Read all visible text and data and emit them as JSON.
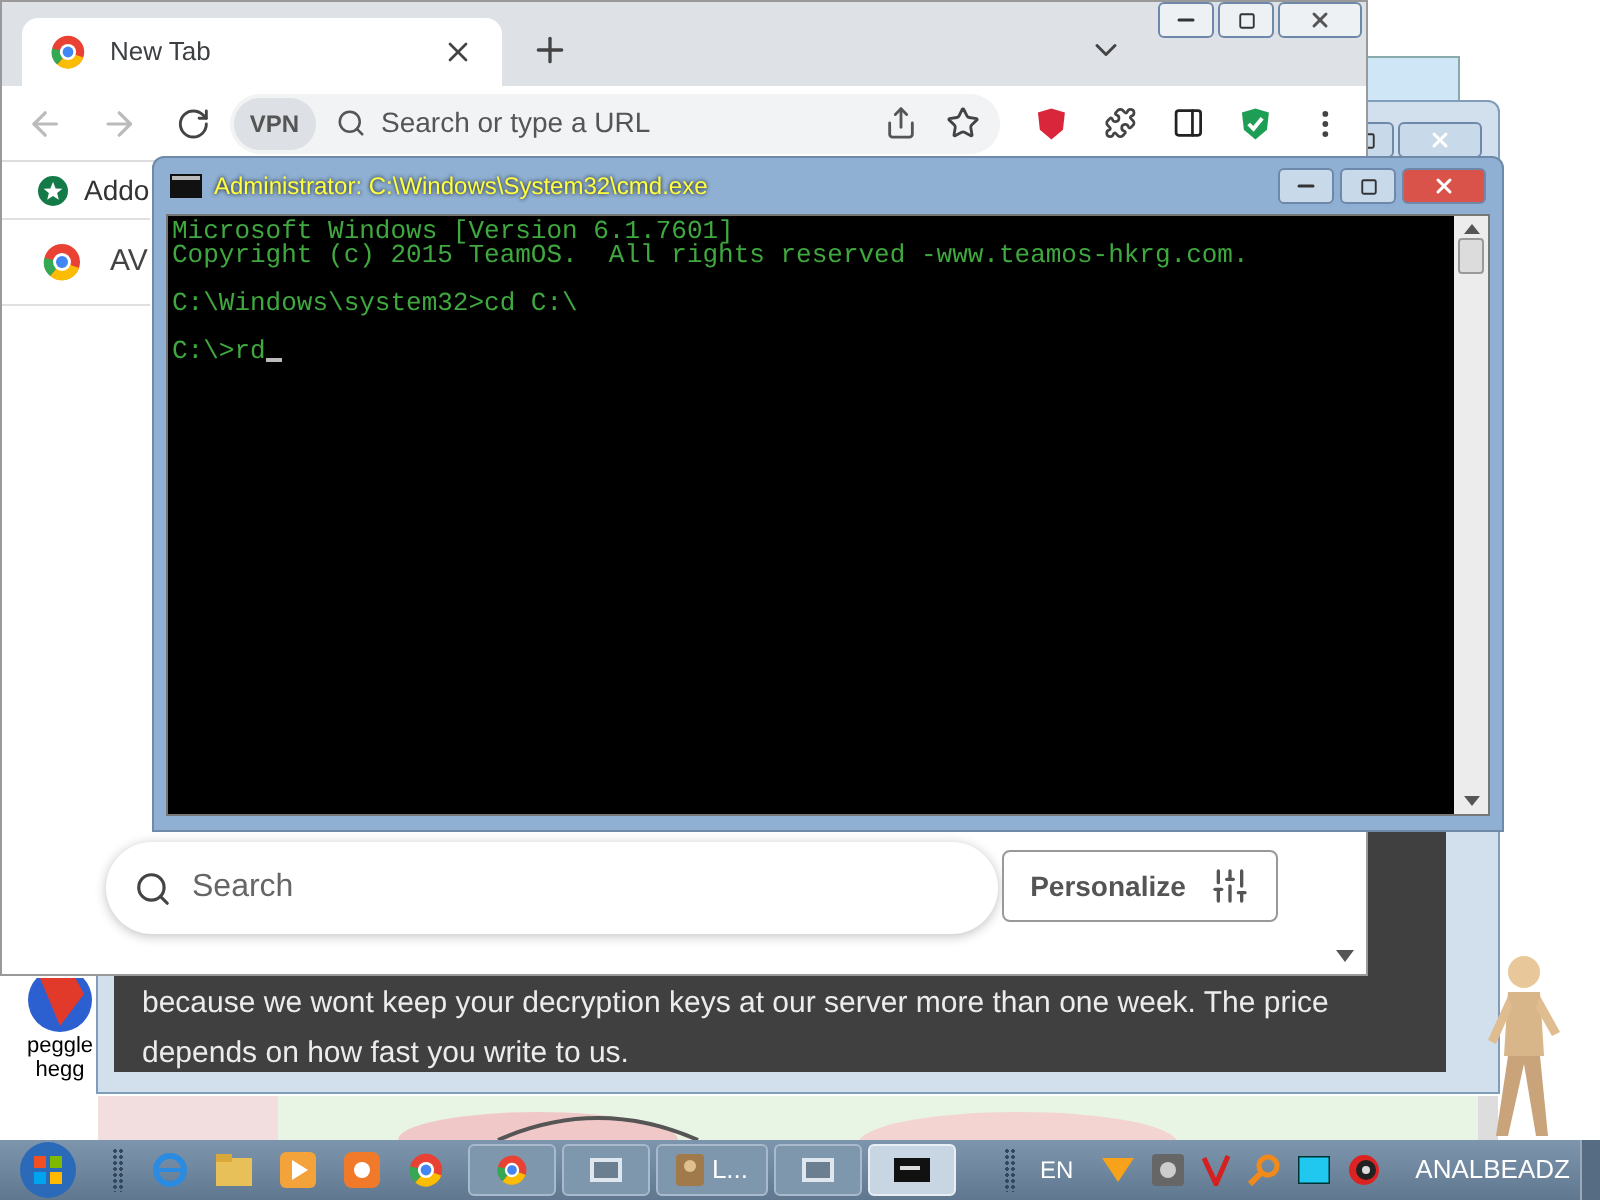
{
  "browser": {
    "tab": {
      "title": "New Tab",
      "selected": true
    },
    "vpn_label": "VPN",
    "address_placeholder": "Search or type a URL",
    "bookmarks": [
      {
        "label": "Addo"
      }
    ],
    "list_items": [
      {
        "label": "AV"
      }
    ],
    "search_placeholder": "Search",
    "personalize": "Personalize"
  },
  "note_window": {
    "lines": [
      "because we wont keep your decryption keys at our server more than one week. The price",
      "depends on how fast you write to us."
    ]
  },
  "cmd": {
    "title": "Administrator: C:\\Windows\\System32\\cmd.exe",
    "blocks": [
      [
        "Microsoft Windows [Version 6.1.7601]",
        "Copyright (c) 2015 TeamOS.  All rights reserved -www.teamos-hkrg.com."
      ],
      [
        "C:\\Windows\\system32>cd C:\\"
      ],
      [
        "C:\\>rd"
      ]
    ]
  },
  "desktop_icons": [
    {
      "lines": [
        "peggle",
        "hegg"
      ]
    }
  ],
  "taskbar": {
    "windows": [
      {
        "kind": "browser",
        "selected": false
      },
      {
        "kind": "window",
        "selected": false
      },
      {
        "kind": "labeled",
        "label": "L...",
        "selected": false
      },
      {
        "kind": "window",
        "selected": false
      },
      {
        "kind": "console",
        "selected": true
      }
    ],
    "language": "EN",
    "user": "ANALBEADZ"
  }
}
